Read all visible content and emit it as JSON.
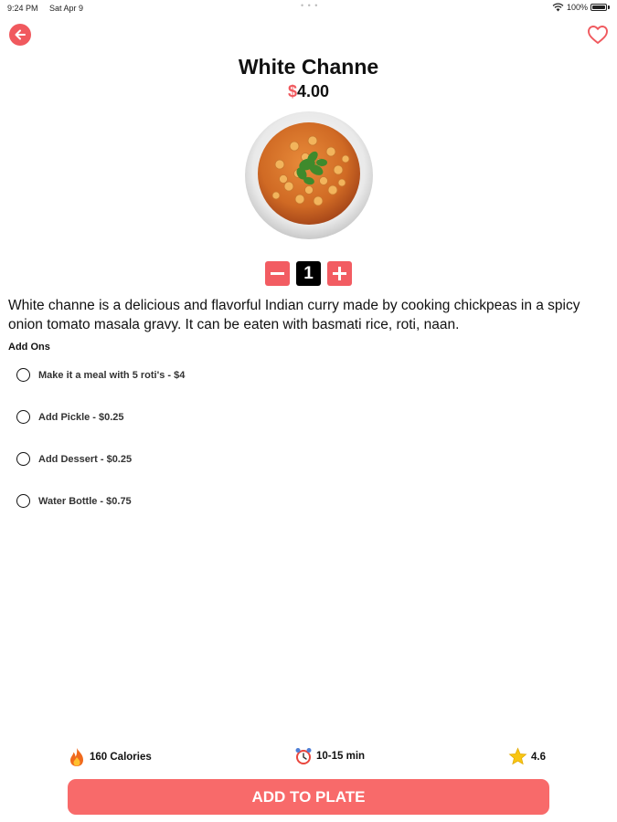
{
  "status_bar": {
    "time": "9:24 PM",
    "date": "Sat Apr 9",
    "battery": "100%"
  },
  "icons": {
    "back": "arrow-left-icon",
    "favorite": "heart-outline-icon",
    "decrement": "minus-icon",
    "increment": "plus-icon",
    "calories": "fire-icon",
    "time": "alarm-clock-icon",
    "rating": "star-icon"
  },
  "colors": {
    "accent": "#f0595e",
    "button": "#f86a6a"
  },
  "item": {
    "title": "White Channe",
    "currency_symbol": "$",
    "price": "4.00",
    "quantity": "1",
    "description": "White channe is a delicious and flavorful Indian curry made by cooking chickpeas in a spicy onion tomato masala gravy. It can be eaten with basmati rice, roti, naan."
  },
  "addons": {
    "heading": "Add Ons",
    "options": [
      "Make it a meal with 5 roti's - $4",
      "Add Pickle - $0.25",
      "Add Dessert - $0.25",
      "Water Bottle - $0.75"
    ]
  },
  "stats": {
    "calories": "160 Calories",
    "time": "10-15 min",
    "rating": "4.6"
  },
  "action": {
    "add_label": "ADD TO PLATE"
  }
}
